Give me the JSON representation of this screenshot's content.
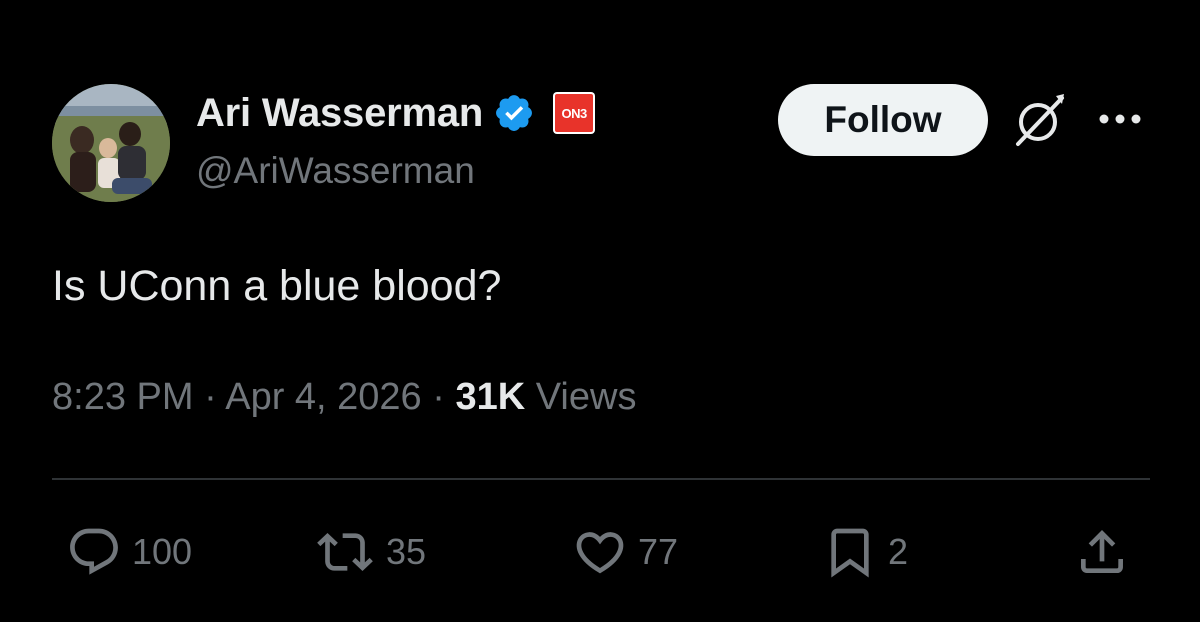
{
  "author": {
    "display_name": "Ari Wasserman",
    "handle": "@AriWasserman",
    "verified_badge_color": "#1d9bf0",
    "affiliate_badge_text": "ON3",
    "affiliate_badge_color": "#e8332a"
  },
  "header": {
    "follow_label": "Follow",
    "grok_icon": "grok-icon",
    "more_icon": "more-horizontal-icon"
  },
  "tweet": {
    "text": "Is UConn a blue blood?",
    "time": "8:23 PM",
    "date": "Apr 4, 2026",
    "separator": "·",
    "views_count": "31K",
    "views_label": "Views"
  },
  "actions": {
    "replies": "100",
    "reposts": "35",
    "likes": "77",
    "bookmarks": "2"
  },
  "colors": {
    "background": "#000000",
    "primary_text": "#e7e9ea",
    "secondary_text": "#71767b",
    "divider": "#2f3336",
    "follow_button_bg": "#eff3f4"
  }
}
